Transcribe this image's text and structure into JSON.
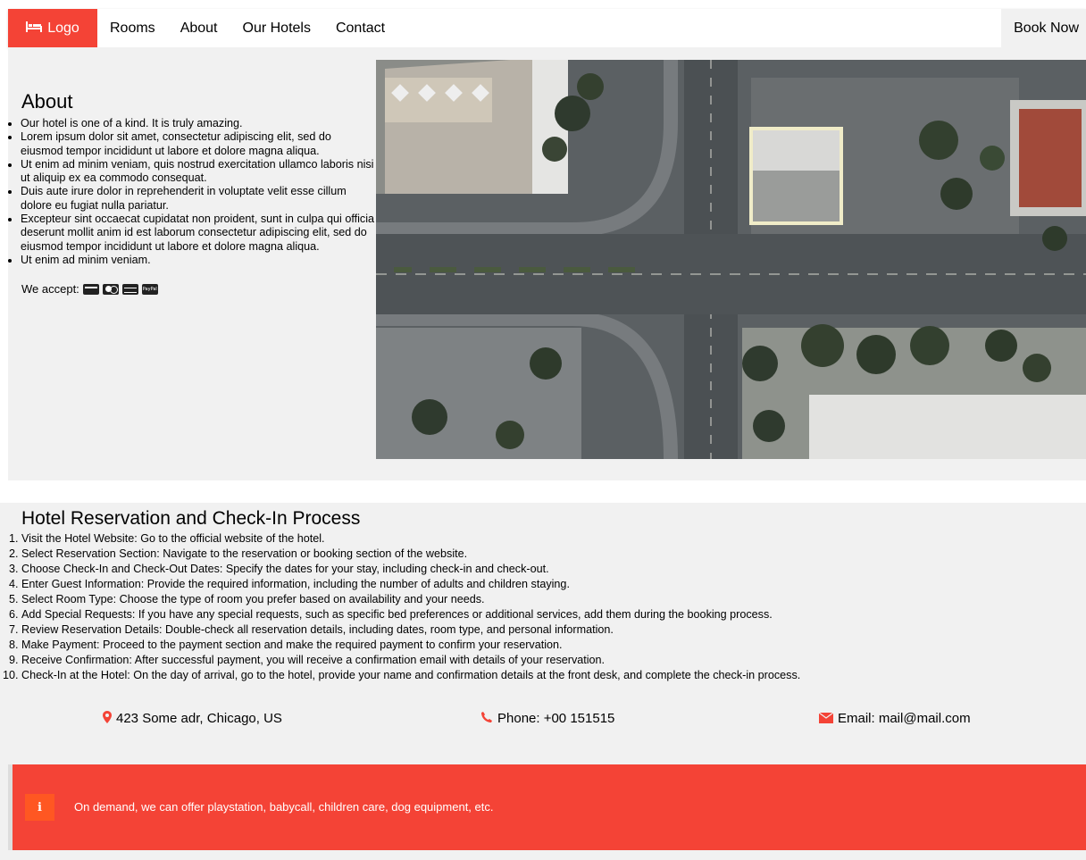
{
  "nav": {
    "logo_label": "Logo",
    "items": [
      "Rooms",
      "About",
      "Our Hotels",
      "Contact"
    ],
    "book_label": "Book Now"
  },
  "about": {
    "title": "About",
    "items": [
      "Our hotel is one of a kind. It is truly amazing.",
      "Lorem ipsum dolor sit amet, consectetur adipiscing elit, sed do eiusmod tempor incididunt ut labore et dolore magna aliqua.",
      "Ut enim ad minim veniam, quis nostrud exercitation ullamco laboris nisi ut aliquip ex ea commodo consequat.",
      "Duis aute irure dolor in reprehenderit in voluptate velit esse cillum dolore eu fugiat nulla pariatur.",
      "Excepteur sint occaecat cupidatat non proident, sunt in culpa qui officia deserunt mollit anim id est laborum consectetur adipiscing elit, sed do eiusmod tempor incididunt ut labore et dolore magna aliqua.",
      "Ut enim ad minim veniam."
    ],
    "accept_label": "We accept:",
    "payment_icons": [
      "credit-card-icon",
      "mastercard-icon",
      "amex-icon",
      "paypal-icon"
    ],
    "paypal_text": "PayPal"
  },
  "reservation": {
    "title": "Hotel Reservation and Check-In Process",
    "steps": [
      "Visit the Hotel Website: Go to the official website of the hotel.",
      "Select Reservation Section: Navigate to the reservation or booking section of the website.",
      "Choose Check-In and Check-Out Dates: Specify the dates for your stay, including check-in and check-out.",
      "Enter Guest Information: Provide the required information, including the number of adults and children staying.",
      "Select Room Type: Choose the type of room you prefer based on availability and your needs.",
      "Add Special Requests: If you have any special requests, such as specific bed preferences or additional services, add them during the booking process.",
      "Review Reservation Details: Double-check all reservation details, including dates, room type, and personal information.",
      "Make Payment: Proceed to the payment section and make the required payment to confirm your reservation.",
      "Receive Confirmation: After successful payment, you will receive a confirmation email with details of your reservation.",
      "Check-In at the Hotel: On the day of arrival, go to the hotel, provide your name and confirmation details at the front desk, and complete the check-in process."
    ]
  },
  "contact": {
    "address": "423 Some adr, Chicago, US",
    "phone": "Phone: +00 151515",
    "email": "Email: mail@mail.com"
  },
  "notice": {
    "icon_text": "i",
    "text": "On demand, we can offer playstation, babycall, children care, dog equipment, etc."
  },
  "colors": {
    "accent": "#f44336",
    "section_bg": "#f1f1f1",
    "notice_icon_bg": "#ff5722"
  }
}
